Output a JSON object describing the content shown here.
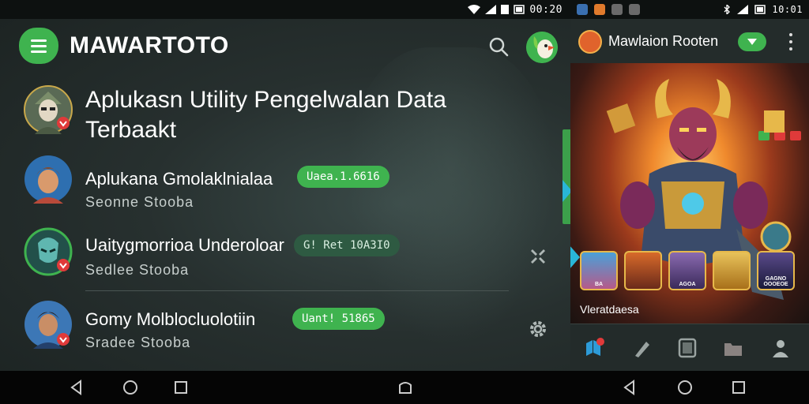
{
  "left_status": {
    "time": "00:20"
  },
  "right_status": {
    "time": "10:01"
  },
  "app": {
    "title": "MAWARTOTO",
    "headline": "Aplukasn Utility Pengelwalan Data Terbaakt"
  },
  "list": [
    {
      "name": "Aplukana Gmolaklnialaa",
      "subtitle": "Seonne  Stooba",
      "badge": "Uaea.1.6616"
    },
    {
      "name": "Uaitygmorrioa Underoloar",
      "subtitle": "Sedlee  Stooba",
      "badge": "G! Ret 10A3I0"
    },
    {
      "name": "Gomy Molblocluolotiin",
      "subtitle": "Sradee  Stooba",
      "badge": "Uant! 51865"
    }
  ],
  "right": {
    "title": "Mawlaion Rooten",
    "caption": "Vleratdaesa",
    "thumbs": [
      "BA",
      "",
      "AGOA",
      "",
      "GAGNO OOOEOE"
    ]
  },
  "colors": {
    "accent": "#3fb34f",
    "teal": "#29b6d8",
    "dark_pill": "#2e5a42",
    "background": "#27302f"
  },
  "icons": {
    "menu": "hamburger-icon",
    "search": "search-icon",
    "puzzle": "puzzle-icon",
    "gear": "gear-icon",
    "more": "more-vert-icon",
    "nav": [
      "home-icon",
      "brush-icon",
      "tablet-icon",
      "folder-icon",
      "person-icon"
    ],
    "system": [
      "back-icon",
      "home-circle-icon",
      "recents-icon"
    ]
  }
}
